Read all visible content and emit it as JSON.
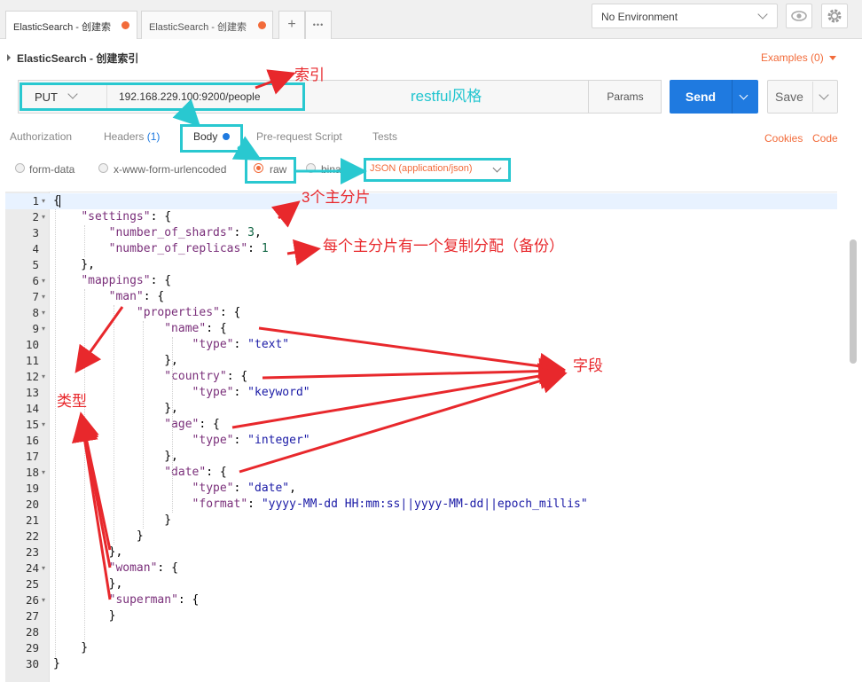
{
  "tabs": [
    {
      "label": "ElasticSearch - 创建索",
      "active": true
    },
    {
      "label": "ElasticSearch - 创建索",
      "active": false
    }
  ],
  "tab_actions": {
    "add": "+",
    "more": "•••"
  },
  "environment": {
    "selected": "No Environment"
  },
  "request": {
    "breadcrumb": "ElasticSearch - 创建索引",
    "examples": "Examples (0)",
    "method": "PUT",
    "url": "192.168.229.100:9200/people",
    "params_label": "Params",
    "send_label": "Send",
    "save_label": "Save"
  },
  "request_tabs": [
    {
      "label": "Authorization"
    },
    {
      "label": "Headers (1)"
    },
    {
      "label": "Body"
    },
    {
      "label": "Pre-request Script"
    },
    {
      "label": "Tests"
    }
  ],
  "links": {
    "cookies": "Cookies",
    "code": "Code"
  },
  "body_types": [
    {
      "label": "form-data",
      "selected": false
    },
    {
      "label": "x-www-form-urlencoded",
      "selected": false
    },
    {
      "label": "raw",
      "selected": true
    },
    {
      "label": "binary",
      "selected": false
    }
  ],
  "content_type": "JSON (application/json)",
  "editor_lines": [
    "{",
    "    \"settings\": {",
    "        \"number_of_shards\": 3,",
    "        \"number_of_replicas\": 1",
    "    },",
    "    \"mappings\": {",
    "        \"man\": {",
    "            \"properties\": {",
    "                \"name\": {",
    "                    \"type\": \"text\"",
    "                },",
    "                \"country\": {",
    "                    \"type\": \"keyword\"",
    "                },",
    "                \"age\": {",
    "                    \"type\": \"integer\"",
    "                },",
    "                \"date\": {",
    "                    \"type\": \"date\",",
    "                    \"format\": \"yyyy-MM-dd HH:mm:ss||yyyy-MM-dd||epoch_millis\"",
    "                }",
    "            }",
    "        },",
    "        \"woman\": {",
    "        },",
    "        \"superman\": {",
    "        }",
    "",
    "    }",
    "}"
  ],
  "fold_lines": [
    1,
    2,
    6,
    7,
    8,
    9,
    12,
    15,
    18,
    24,
    26
  ],
  "annotations": {
    "index": "索引",
    "restful": "restful风格",
    "shards": "3个主分片",
    "replicas": "每个主分片有一个复制分配（备份）",
    "fields": "字段",
    "types": "类型"
  },
  "colors": {
    "accent": "#f26b3a",
    "send": "#1f7ae0",
    "annotation_red": "#e8282c",
    "annotation_cyan": "#29c8d0"
  }
}
